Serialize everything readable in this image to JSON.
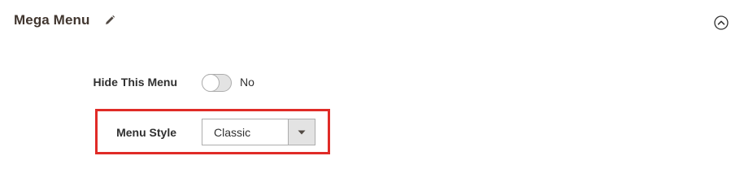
{
  "section": {
    "title": "Mega Menu",
    "edit_icon": "pencil-icon",
    "collapse_icon": "chevron-up-circle-icon"
  },
  "fields": {
    "hide_menu": {
      "label": "Hide This Menu",
      "value": "No",
      "enabled": false
    },
    "menu_style": {
      "label": "Menu Style",
      "selected": "Classic",
      "highlight_color": "#e02b27"
    }
  }
}
